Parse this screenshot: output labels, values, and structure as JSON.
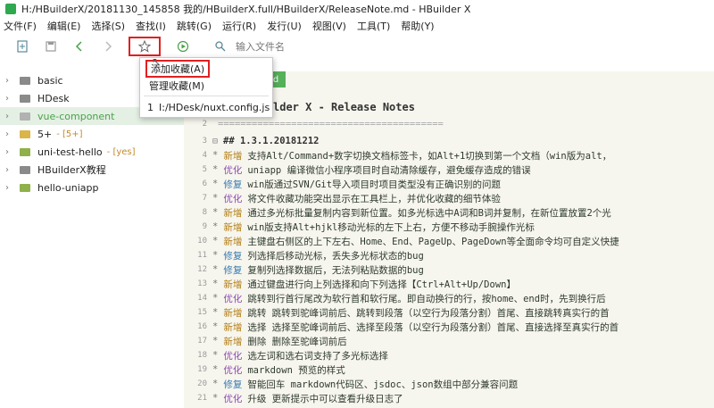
{
  "titlebar": {
    "title": "H:/HBuilderX/20181130_145858 我的/HBuilderX.full/HBuilderX/ReleaseNote.md - HBuilder X"
  },
  "menubar": {
    "items": [
      "文件(F)",
      "编辑(E)",
      "选择(S)",
      "查找(I)",
      "跳转(G)",
      "运行(R)",
      "发行(U)",
      "视图(V)",
      "工具(T)",
      "帮助(Y)"
    ]
  },
  "toolbar": {
    "search_placeholder": "输入文件名"
  },
  "dropdown": {
    "add_favorite": "添加收藏(A)",
    "manage_favorites": "管理收藏(M)",
    "recent_index": "1",
    "recent_path": "I:/HDesk/nuxt.config.js"
  },
  "sidebar": {
    "items": [
      {
        "label": "basic",
        "badge": ""
      },
      {
        "label": "HDesk",
        "badge": ""
      },
      {
        "label": "vue-component",
        "badge": ""
      },
      {
        "label": "5+",
        "badge": "- [5+]"
      },
      {
        "label": "uni-test-hello",
        "badge": "- [yes]"
      },
      {
        "label": "HBuilderX教程",
        "badge": ""
      },
      {
        "label": "hello-uniapp",
        "badge": ""
      }
    ]
  },
  "editor": {
    "tab_label": "d",
    "title_line": "lder X - Release Notes",
    "separator_line": "========================================",
    "lines": [
      {
        "n": "3",
        "tag": "",
        "text": "## 1.3.1.20181212"
      },
      {
        "n": "4",
        "tag": "新增",
        "text": "支持Alt/Command+数字切换文档标签卡，如Alt+1切换到第一个文档（win版为alt，"
      },
      {
        "n": "5",
        "tag": "优化",
        "text": "uniapp 编译微信小程序项目时自动清除缓存，避免缓存造成的错误"
      },
      {
        "n": "6",
        "tag": "修复",
        "text": "win版通过SVN/Git导入项目时项目类型没有正确识别的问题"
      },
      {
        "n": "7",
        "tag": "优化",
        "text": "将文件收藏功能突出显示在工具栏上，并优化收藏的细节体验"
      },
      {
        "n": "8",
        "tag": "新增",
        "text": "通过多光标批量复制内容到新位置。如多光标选中A词和B词并复制，在新位置放置2个光"
      },
      {
        "n": "9",
        "tag": "新增",
        "text": "win版支持Alt+hjkl移动光标的左下上右，方便不移动手腕操作光标"
      },
      {
        "n": "10",
        "tag": "新增",
        "text": "主键盘右侧区的上下左右、Home、End、PageUp、PageDown等全面命令均可自定义快捷"
      },
      {
        "n": "11",
        "tag": "修复",
        "text": "列选择后移动光标，丢失多光标状态的bug"
      },
      {
        "n": "12",
        "tag": "修复",
        "text": "复制列选择数据后，无法列粘贴数据的bug"
      },
      {
        "n": "13",
        "tag": "新增",
        "text": "通过键盘进行向上列选择和向下列选择【Ctrl+Alt+Up/Down】"
      },
      {
        "n": "14",
        "tag": "优化",
        "text": "跳转到行首行尾改为软行首和软行尾。即自动换行的行，按home、end时，先到换行后"
      },
      {
        "n": "15",
        "tag": "新增",
        "text": "跳转 跳转到驼峰词前后、跳转到段落（以空行为段落分割）首尾、直接跳转真实行的首"
      },
      {
        "n": "16",
        "tag": "新增",
        "text": "选择 选择至驼峰词前后、选择至段落（以空行为段落分割）首尾、直接选择至真实行的首"
      },
      {
        "n": "17",
        "tag": "新增",
        "text": "删除 删除至驼峰词前后"
      },
      {
        "n": "18",
        "tag": "优化",
        "text": "选左词和选右词支持了多光标选择"
      },
      {
        "n": "19",
        "tag": "优化",
        "text": "markdown 预览的样式"
      },
      {
        "n": "20",
        "tag": "修复",
        "text": "智能回车 markdown代码区、jsdoc、json数组中部分兼容问题"
      },
      {
        "n": "21",
        "tag": "优化",
        "text": "升级 更新提示中可以查看升级日志了"
      }
    ]
  }
}
